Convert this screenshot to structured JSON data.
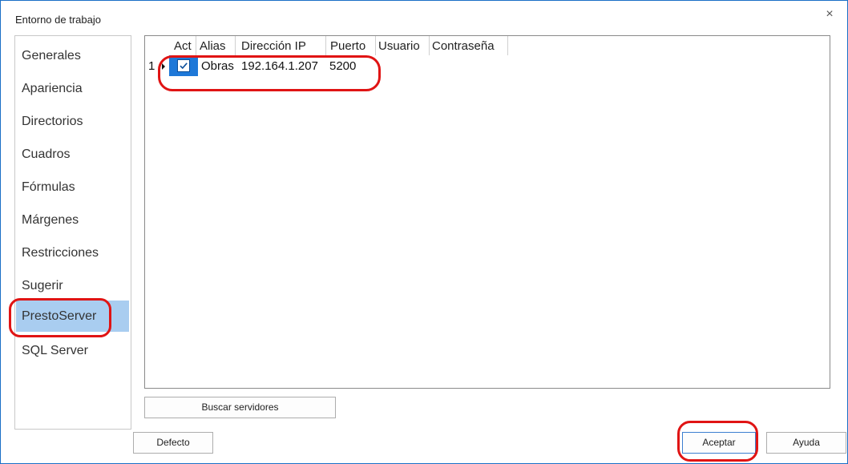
{
  "window": {
    "title": "Entorno de trabajo",
    "close_glyph": "×"
  },
  "sidebar": {
    "items": [
      {
        "label": "Generales"
      },
      {
        "label": "Apariencia"
      },
      {
        "label": "Directorios"
      },
      {
        "label": "Cuadros"
      },
      {
        "label": "Fórmulas"
      },
      {
        "label": "Márgenes"
      },
      {
        "label": "Restricciones"
      },
      {
        "label": "Sugerir"
      },
      {
        "label": "PrestoServer",
        "selected": true
      },
      {
        "label": "SQL Server"
      }
    ]
  },
  "grid": {
    "headers": {
      "act": "Act",
      "alias": "Alias",
      "ip": "Dirección IP",
      "port": "Puerto",
      "user": "Usuario",
      "password": "Contraseña"
    },
    "rows": [
      {
        "index": "1",
        "act": true,
        "alias": "Obras",
        "ip": "192.164.1.207",
        "port": "5200",
        "user": "",
        "password": ""
      }
    ]
  },
  "buttons": {
    "search_servers": "Buscar servidores",
    "default": "Defecto",
    "accept": "Aceptar",
    "help": "Ayuda"
  },
  "colors": {
    "selection": "#a9cdf0",
    "active_cell": "#1e78d8",
    "annotation": "#e01414",
    "window_border": "#1a6fc7"
  }
}
